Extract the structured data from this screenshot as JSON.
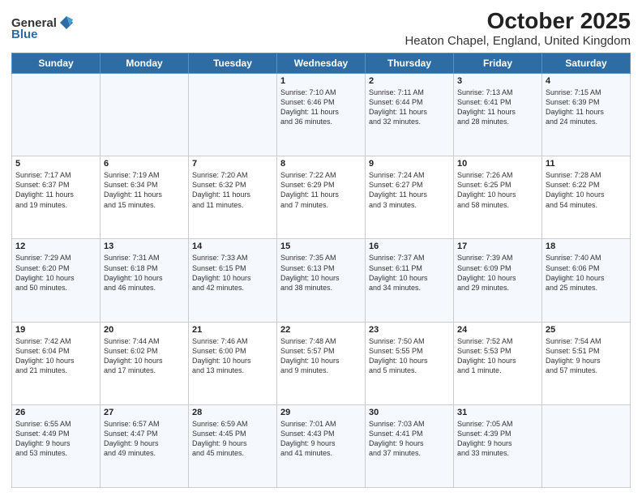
{
  "logo": {
    "general": "General",
    "blue": "Blue"
  },
  "title": "October 2025",
  "subtitle": "Heaton Chapel, England, United Kingdom",
  "header_days": [
    "Sunday",
    "Monday",
    "Tuesday",
    "Wednesday",
    "Thursday",
    "Friday",
    "Saturday"
  ],
  "weeks": [
    [
      {
        "day": "",
        "info": ""
      },
      {
        "day": "",
        "info": ""
      },
      {
        "day": "",
        "info": ""
      },
      {
        "day": "1",
        "info": "Sunrise: 7:10 AM\nSunset: 6:46 PM\nDaylight: 11 hours\nand 36 minutes."
      },
      {
        "day": "2",
        "info": "Sunrise: 7:11 AM\nSunset: 6:44 PM\nDaylight: 11 hours\nand 32 minutes."
      },
      {
        "day": "3",
        "info": "Sunrise: 7:13 AM\nSunset: 6:41 PM\nDaylight: 11 hours\nand 28 minutes."
      },
      {
        "day": "4",
        "info": "Sunrise: 7:15 AM\nSunset: 6:39 PM\nDaylight: 11 hours\nand 24 minutes."
      }
    ],
    [
      {
        "day": "5",
        "info": "Sunrise: 7:17 AM\nSunset: 6:37 PM\nDaylight: 11 hours\nand 19 minutes."
      },
      {
        "day": "6",
        "info": "Sunrise: 7:19 AM\nSunset: 6:34 PM\nDaylight: 11 hours\nand 15 minutes."
      },
      {
        "day": "7",
        "info": "Sunrise: 7:20 AM\nSunset: 6:32 PM\nDaylight: 11 hours\nand 11 minutes."
      },
      {
        "day": "8",
        "info": "Sunrise: 7:22 AM\nSunset: 6:29 PM\nDaylight: 11 hours\nand 7 minutes."
      },
      {
        "day": "9",
        "info": "Sunrise: 7:24 AM\nSunset: 6:27 PM\nDaylight: 11 hours\nand 3 minutes."
      },
      {
        "day": "10",
        "info": "Sunrise: 7:26 AM\nSunset: 6:25 PM\nDaylight: 10 hours\nand 58 minutes."
      },
      {
        "day": "11",
        "info": "Sunrise: 7:28 AM\nSunset: 6:22 PM\nDaylight: 10 hours\nand 54 minutes."
      }
    ],
    [
      {
        "day": "12",
        "info": "Sunrise: 7:29 AM\nSunset: 6:20 PM\nDaylight: 10 hours\nand 50 minutes."
      },
      {
        "day": "13",
        "info": "Sunrise: 7:31 AM\nSunset: 6:18 PM\nDaylight: 10 hours\nand 46 minutes."
      },
      {
        "day": "14",
        "info": "Sunrise: 7:33 AM\nSunset: 6:15 PM\nDaylight: 10 hours\nand 42 minutes."
      },
      {
        "day": "15",
        "info": "Sunrise: 7:35 AM\nSunset: 6:13 PM\nDaylight: 10 hours\nand 38 minutes."
      },
      {
        "day": "16",
        "info": "Sunrise: 7:37 AM\nSunset: 6:11 PM\nDaylight: 10 hours\nand 34 minutes."
      },
      {
        "day": "17",
        "info": "Sunrise: 7:39 AM\nSunset: 6:09 PM\nDaylight: 10 hours\nand 29 minutes."
      },
      {
        "day": "18",
        "info": "Sunrise: 7:40 AM\nSunset: 6:06 PM\nDaylight: 10 hours\nand 25 minutes."
      }
    ],
    [
      {
        "day": "19",
        "info": "Sunrise: 7:42 AM\nSunset: 6:04 PM\nDaylight: 10 hours\nand 21 minutes."
      },
      {
        "day": "20",
        "info": "Sunrise: 7:44 AM\nSunset: 6:02 PM\nDaylight: 10 hours\nand 17 minutes."
      },
      {
        "day": "21",
        "info": "Sunrise: 7:46 AM\nSunset: 6:00 PM\nDaylight: 10 hours\nand 13 minutes."
      },
      {
        "day": "22",
        "info": "Sunrise: 7:48 AM\nSunset: 5:57 PM\nDaylight: 10 hours\nand 9 minutes."
      },
      {
        "day": "23",
        "info": "Sunrise: 7:50 AM\nSunset: 5:55 PM\nDaylight: 10 hours\nand 5 minutes."
      },
      {
        "day": "24",
        "info": "Sunrise: 7:52 AM\nSunset: 5:53 PM\nDaylight: 10 hours\nand 1 minute."
      },
      {
        "day": "25",
        "info": "Sunrise: 7:54 AM\nSunset: 5:51 PM\nDaylight: 9 hours\nand 57 minutes."
      }
    ],
    [
      {
        "day": "26",
        "info": "Sunrise: 6:55 AM\nSunset: 4:49 PM\nDaylight: 9 hours\nand 53 minutes."
      },
      {
        "day": "27",
        "info": "Sunrise: 6:57 AM\nSunset: 4:47 PM\nDaylight: 9 hours\nand 49 minutes."
      },
      {
        "day": "28",
        "info": "Sunrise: 6:59 AM\nSunset: 4:45 PM\nDaylight: 9 hours\nand 45 minutes."
      },
      {
        "day": "29",
        "info": "Sunrise: 7:01 AM\nSunset: 4:43 PM\nDaylight: 9 hours\nand 41 minutes."
      },
      {
        "day": "30",
        "info": "Sunrise: 7:03 AM\nSunset: 4:41 PM\nDaylight: 9 hours\nand 37 minutes."
      },
      {
        "day": "31",
        "info": "Sunrise: 7:05 AM\nSunset: 4:39 PM\nDaylight: 9 hours\nand 33 minutes."
      },
      {
        "day": "",
        "info": ""
      }
    ]
  ]
}
